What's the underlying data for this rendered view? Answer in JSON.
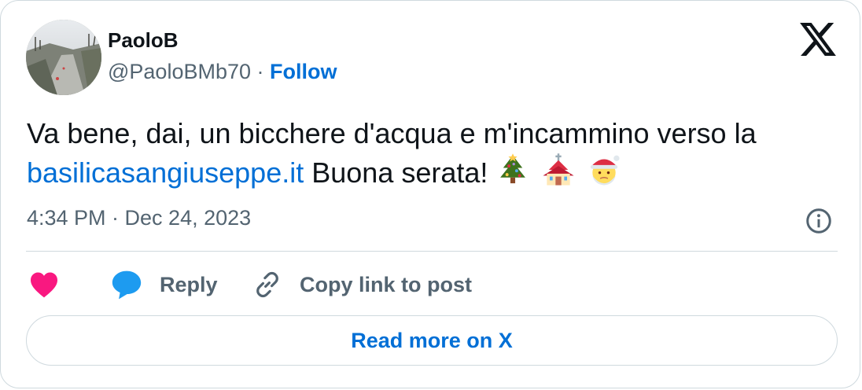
{
  "author": {
    "name": "PaoloB",
    "handle": "@PaoloBMb70",
    "separator": " · ",
    "follow_label": "Follow"
  },
  "tweet": {
    "text_before": "Va bene, dai, un bicchere d'acqua e m'incammino verso la ",
    "link_text": "basilicasangiuseppe.it",
    "text_after": " Buona serata!",
    "emojis": [
      "christmas-tree",
      "church",
      "santa-claus"
    ]
  },
  "meta": {
    "timestamp": "4:34 PM · Dec 24, 2023"
  },
  "actions": {
    "reply_label": "Reply",
    "copy_label": "Copy link to post"
  },
  "footer": {
    "read_more_label": "Read more on X"
  },
  "colors": {
    "link": "#006fd6",
    "muted": "#536471",
    "heart": "#f91880",
    "reply": "#1d9bf0",
    "border": "#cfd9de"
  },
  "icons": {
    "brand": "x-logo-icon",
    "info": "info-icon",
    "like": "heart-icon",
    "reply": "speech-bubble-icon",
    "copy": "link-icon"
  }
}
